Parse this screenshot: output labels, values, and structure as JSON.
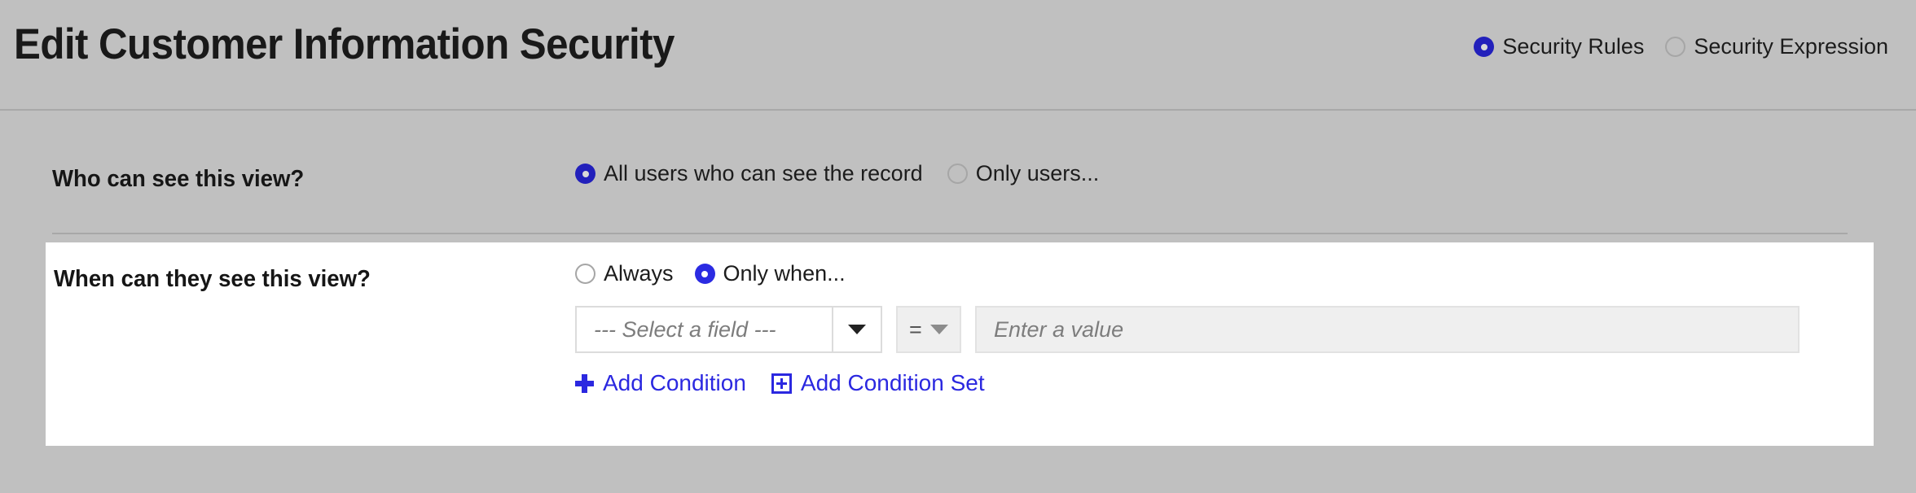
{
  "header": {
    "title": "Edit Customer Information Security",
    "mode_options": [
      {
        "label": "Security Rules",
        "selected": true
      },
      {
        "label": "Security Expression",
        "selected": false
      }
    ]
  },
  "who_section": {
    "label": "Who can see this view?",
    "options": [
      {
        "label": "All users who can see the record",
        "selected": true
      },
      {
        "label": "Only users...",
        "selected": false
      }
    ]
  },
  "when_section": {
    "label": "When can they see this view?",
    "options": [
      {
        "label": "Always",
        "selected": false
      },
      {
        "label": "Only when...",
        "selected": true
      }
    ],
    "condition": {
      "field_placeholder": "--- Select a field ---",
      "field_dropdown_icon": "chevron-down-icon",
      "operator_value": "=",
      "operator_dropdown_icon": "chevron-down-icon",
      "value_placeholder": "Enter a value"
    },
    "actions": [
      {
        "label": "Add Condition",
        "icon": "plus-icon"
      },
      {
        "label": "Add Condition Set",
        "icon": "box-plus-icon"
      }
    ]
  },
  "colors": {
    "page_background": "#c0c0c0",
    "card_background": "#ffffff",
    "accent_blue": "#2b28e0",
    "radio_selected_dark": "#2220bb",
    "divider": "#a8a8a8",
    "input_fill": "#efefef",
    "placeholder_text": "#7d7d7d"
  }
}
